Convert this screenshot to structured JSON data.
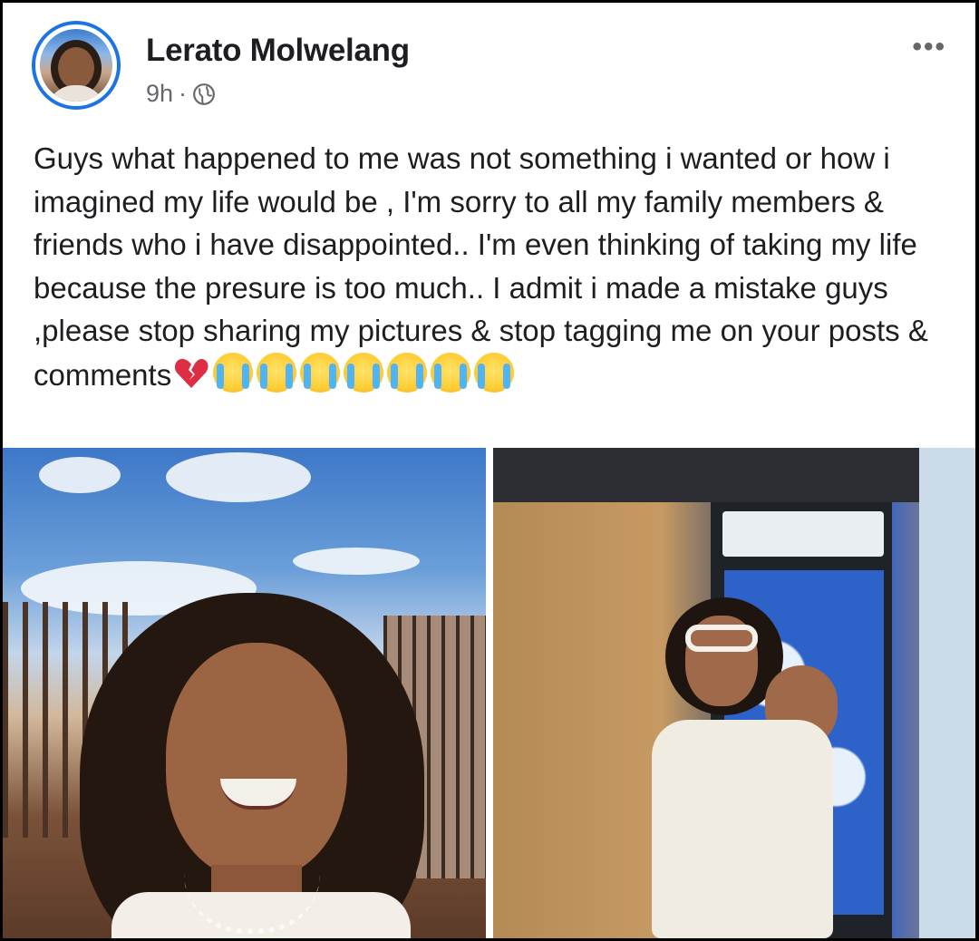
{
  "post": {
    "author": "Lerato Molwelang",
    "time": "9h",
    "separator": "·",
    "privacy_icon": "globe-icon",
    "more_icon": "more-options-icon",
    "more_label": "•••",
    "text": "Guys what happened to me was not something i wanted or how i imagined my life would be , I'm sorry to all my family members & friends who i have disappointed.. I'm even thinking of taking my life because the presure is too much.. I admit i made a mistake guys ,please stop sharing my pictures & stop tagging me on your posts & comments",
    "emojis": [
      "💔",
      "😭",
      "😭",
      "😭",
      "😭",
      "😭",
      "😭",
      "😭"
    ]
  },
  "photos": [
    {
      "name": "photo-selfie-smiling"
    },
    {
      "name": "photo-posing-by-fridge"
    }
  ],
  "colors": {
    "accent": "#1b74e4",
    "text": "#1c1e21",
    "secondary_text": "#65676b",
    "background": "#ffffff"
  }
}
